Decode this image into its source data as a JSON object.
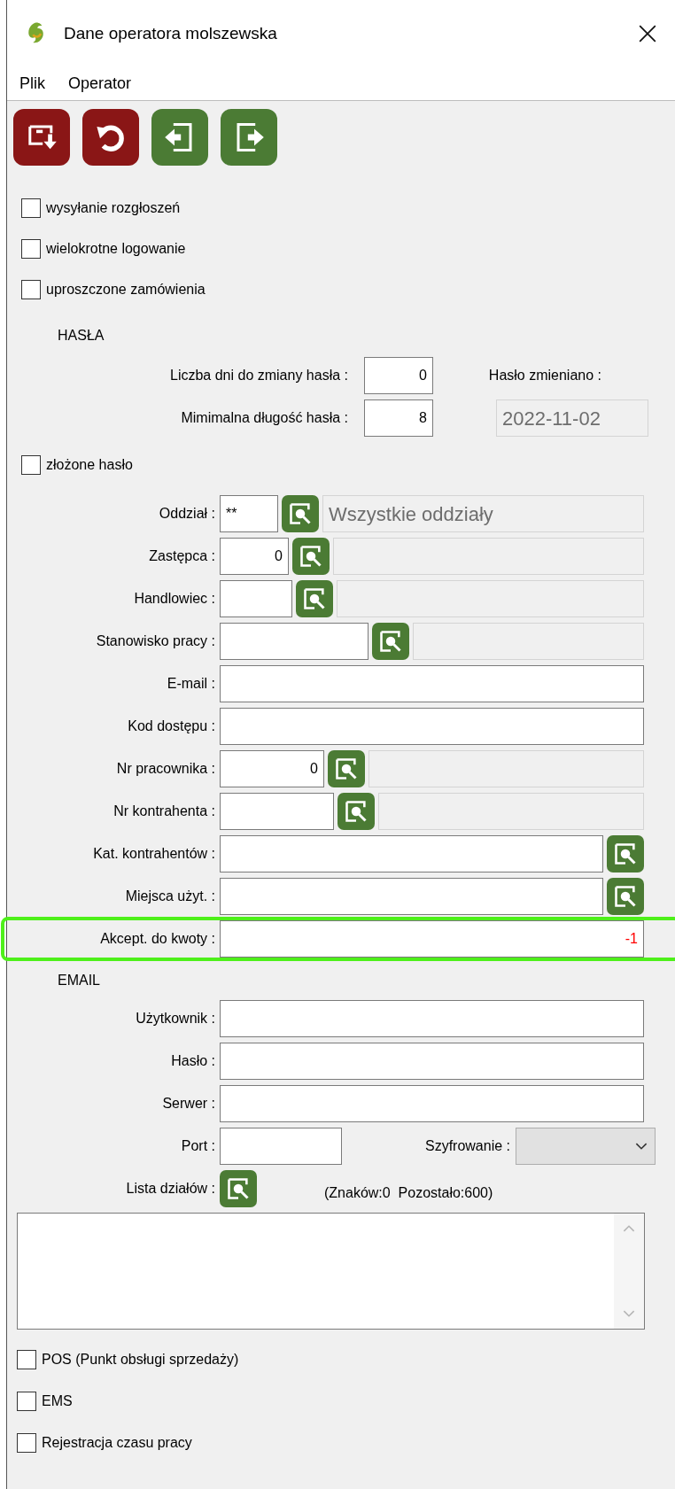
{
  "window": {
    "title": "Dane operatora molszewska"
  },
  "menu": [
    {
      "label": "Plik"
    },
    {
      "label": "Operator"
    }
  ],
  "toolbar": [
    {
      "kind": "save"
    },
    {
      "kind": "undo"
    },
    {
      "kind": "previous"
    },
    {
      "kind": "next"
    }
  ],
  "options": [
    {
      "label": "wysyłanie rozgłoszeń",
      "checked": false
    },
    {
      "label": "wielokrotne logowanie",
      "checked": false
    },
    {
      "label": "uproszczone zamówienia",
      "checked": false
    }
  ],
  "password": {
    "heading": "HASŁA",
    "fields": [
      {
        "label": "Liczba dni do zmiany hasła :",
        "value": "0"
      },
      {
        "label": "Mimimalna długość hasła :",
        "value": "8"
      }
    ],
    "changed_label": "Hasło zmieniano :",
    "changed_value": "2022-11-02",
    "complex": {
      "label": "złożone hasło",
      "checked": false
    }
  },
  "fields": [
    {
      "label": "Oddział :",
      "kind": "lookup",
      "code": "**",
      "name": "Wszystkie oddziały"
    },
    {
      "label": "Zastępca :",
      "kind": "lookup",
      "code": "0"
    },
    {
      "label": "Handlowiec :",
      "kind": "lookup"
    },
    {
      "label": "Stanowisko pracy :",
      "kind": "lookup"
    },
    {
      "label": "E-mail :",
      "kind": "text"
    },
    {
      "label": "Kod dostępu :",
      "kind": "text"
    },
    {
      "label": "Nr pracownika :",
      "kind": "lookup",
      "code": "0"
    },
    {
      "label": "Nr kontrahenta :",
      "kind": "lookup"
    },
    {
      "label": "Kat. kontrahentów :",
      "kind": "picker"
    },
    {
      "label": "Miejsca użyt. :",
      "kind": "picker"
    },
    {
      "label": "Akcept. do kwoty :",
      "kind": "text",
      "value": "-1",
      "negative": true,
      "highlighted": true
    }
  ],
  "email": {
    "heading": "EMAIL",
    "fields": [
      {
        "label": "Użytkownik :"
      },
      {
        "label": "Hasło :"
      },
      {
        "label": "Serwer :"
      }
    ],
    "port_label": "Port :",
    "encryption_label": "Szyfrowanie :",
    "departments_label": "Lista działów :",
    "counter": "(Znaków:0  Pozostało:600)"
  },
  "modules": [
    {
      "label": "POS (Punkt obsługi sprzedaży)",
      "checked": false
    },
    {
      "label": "EMS",
      "checked": false
    },
    {
      "label": "Rejestracja czasu pracy",
      "checked": false
    }
  ]
}
